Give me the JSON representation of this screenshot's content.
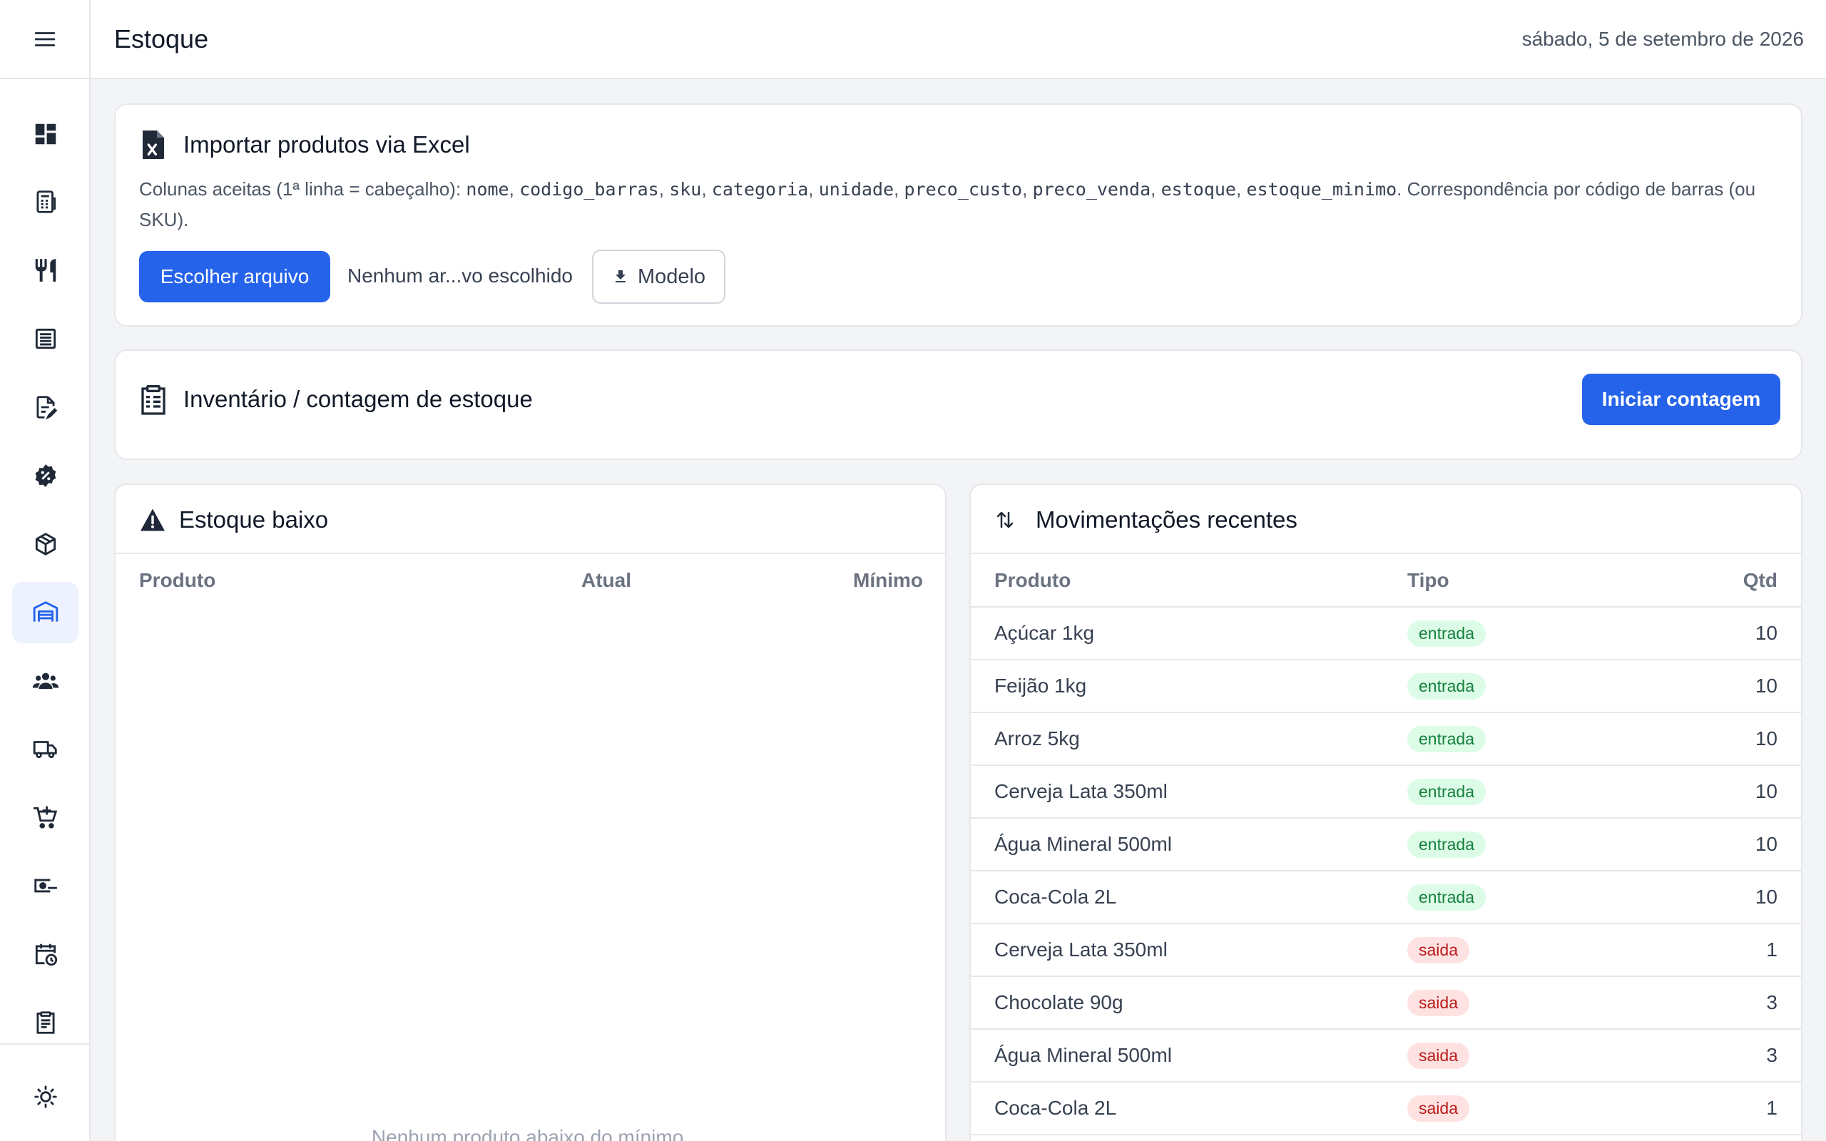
{
  "header": {
    "title": "Estoque",
    "date": "sábado, 5 de setembro de 2026"
  },
  "sidebar": {
    "items": [
      {
        "icon": "dashboard-icon"
      },
      {
        "icon": "cash-register-icon"
      },
      {
        "icon": "fork-knife-icon"
      },
      {
        "icon": "list-icon"
      },
      {
        "icon": "edit-document-icon"
      },
      {
        "icon": "discount-badge-icon"
      },
      {
        "icon": "package-icon"
      },
      {
        "icon": "warehouse-icon",
        "active": true
      },
      {
        "icon": "people-icon"
      },
      {
        "icon": "truck-icon"
      },
      {
        "icon": "cart-add-icon"
      },
      {
        "icon": "money-icon"
      },
      {
        "icon": "calendar-clock-icon"
      },
      {
        "icon": "clipboard-icon"
      }
    ],
    "bottom_icon": "theme-toggle-icon"
  },
  "import": {
    "title": "Importar produtos via Excel",
    "desc_prefix": "Colunas aceitas (1ª linha = cabeçalho): ",
    "columns": [
      "nome",
      "codigo_barras",
      "sku",
      "categoria",
      "unidade",
      "preco_custo",
      "preco_venda",
      "estoque",
      "estoque_minimo"
    ],
    "desc_suffix": ". Correspondência por código de barras (ou SKU).",
    "choose_label": "Escolher arquivo",
    "file_status": "Nenhum ar...vo escolhido",
    "template_label": "Modelo"
  },
  "inventory": {
    "title": "Inventário / contagem de estoque",
    "button_label": "Iniciar contagem"
  },
  "low_stock": {
    "title": "Estoque baixo",
    "headers": {
      "product": "Produto",
      "current": "Atual",
      "minimum": "Mínimo"
    },
    "empty_message": "Nenhum produto abaixo do mínimo."
  },
  "movements": {
    "title": "Movimentações recentes",
    "headers": {
      "product": "Produto",
      "type": "Tipo",
      "qty": "Qtd"
    },
    "rows": [
      {
        "product": "Açúcar 1kg",
        "type": "entrada",
        "qty": "10"
      },
      {
        "product": "Feijão 1kg",
        "type": "entrada",
        "qty": "10"
      },
      {
        "product": "Arroz 5kg",
        "type": "entrada",
        "qty": "10"
      },
      {
        "product": "Cerveja Lata 350ml",
        "type": "entrada",
        "qty": "10"
      },
      {
        "product": "Água Mineral 500ml",
        "type": "entrada",
        "qty": "10"
      },
      {
        "product": "Coca-Cola 2L",
        "type": "entrada",
        "qty": "10"
      },
      {
        "product": "Cerveja Lata 350ml",
        "type": "saida",
        "qty": "1"
      },
      {
        "product": "Chocolate 90g",
        "type": "saida",
        "qty": "3"
      },
      {
        "product": "Água Mineral 500ml",
        "type": "saida",
        "qty": "3"
      },
      {
        "product": "Coca-Cola 2L",
        "type": "saida",
        "qty": "1"
      }
    ]
  },
  "colors": {
    "primary": "#2563eb",
    "entrada_bg": "#dcfce7",
    "entrada_text": "#15803d",
    "saida_bg": "#fee2e2",
    "saida_text": "#b91c1c",
    "active_nav": "#2563eb"
  }
}
